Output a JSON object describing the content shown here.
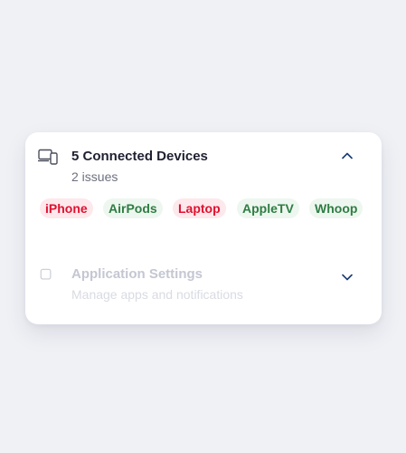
{
  "devices_section": {
    "title": "5 Connected Devices",
    "subtitle": "2 issues",
    "icon": "devices-icon",
    "chevron": "chevron-up-icon",
    "tags": [
      {
        "label": "iPhone",
        "status": "issue"
      },
      {
        "label": "AirPods",
        "status": "ok"
      },
      {
        "label": "Laptop",
        "status": "issue"
      },
      {
        "label": "AppleTV",
        "status": "ok"
      },
      {
        "label": "Whoop",
        "status": "ok"
      }
    ]
  },
  "settings_section": {
    "title": "Application Settings",
    "subtitle": "Manage apps and notifications",
    "icon": "settings-square-icon",
    "chevron": "chevron-down-icon"
  },
  "colors": {
    "issue_text": "#e0112f",
    "issue_bg": "#fde8ec",
    "ok_text": "#2f7d43",
    "ok_bg": "#edf7ef",
    "accent": "#1b3a73"
  }
}
